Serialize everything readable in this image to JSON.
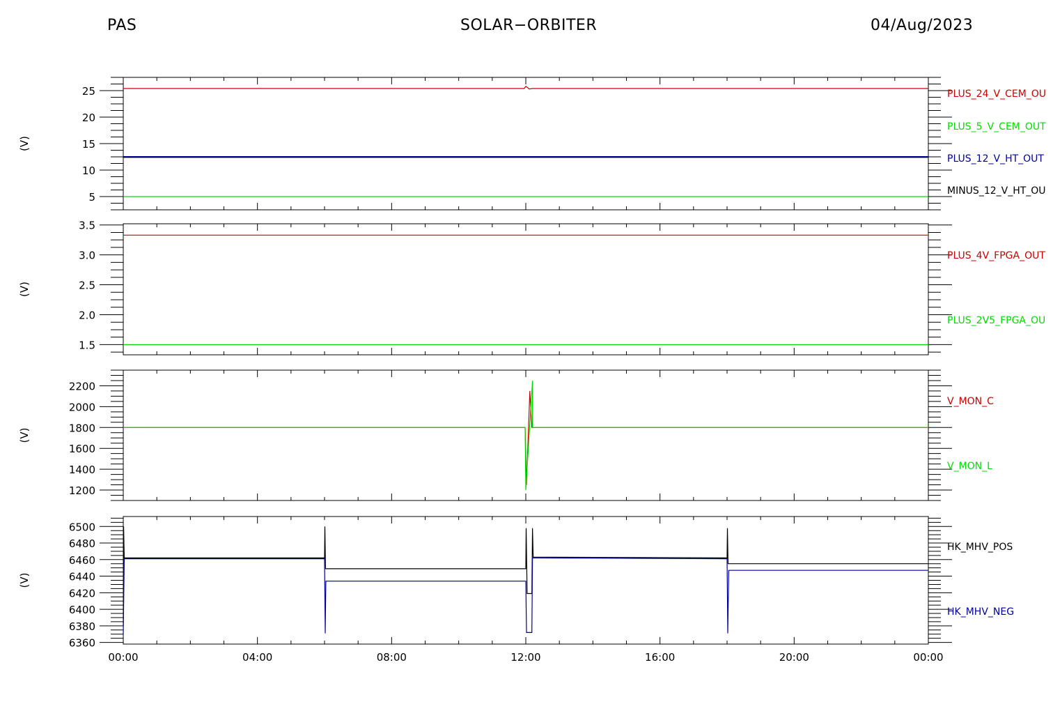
{
  "header": {
    "left": "PAS",
    "center": "SOLAR−ORBITER",
    "right": "04/Aug/2023"
  },
  "colors": {
    "red": "#cc0000",
    "green": "#00dd00",
    "blue": "#000099",
    "black": "#000000"
  },
  "chart_data": {
    "type": "line",
    "x_ticks": [
      "00:00",
      "04:00",
      "08:00",
      "12:00",
      "16:00",
      "20:00",
      "00:00"
    ],
    "xlim_hours": [
      0,
      24
    ],
    "panels": [
      {
        "ylabel": "(V)",
        "ylim": [
          2.5,
          27.5
        ],
        "yticks": [
          5,
          10,
          15,
          20,
          25
        ],
        "ytick_labels": [
          "5",
          "10",
          "15",
          "20",
          "25"
        ],
        "series": [
          {
            "name": "PLUS_24_V_CEM_OUT",
            "legend_text": "PLUS_24_V_CEM_OU",
            "color": "red",
            "x": [
              0,
              11.95,
              12.0,
              12.05,
              12.1,
              12.2,
              24
            ],
            "y": [
              25.4,
              25.4,
              25.8,
              25.6,
              25.3,
              25.4,
              25.4
            ]
          },
          {
            "name": "PLUS_5_V_CEM_OUT",
            "legend_text": "PLUS_5_V_CEM_OUT",
            "color": "green",
            "x": [
              0,
              24
            ],
            "y": [
              5.0,
              5.0
            ]
          },
          {
            "name": "PLUS_12_V_HT_OUT",
            "legend_text": "PLUS_12_V_HT_OUT",
            "color": "blue",
            "x": [
              0,
              24
            ],
            "y": [
              12.5,
              12.5
            ]
          },
          {
            "name": "MINUS_12_V_HT_OUT",
            "legend_text": "MINUS_12_V_HT_OU",
            "color": "black",
            "x": [
              0,
              24
            ],
            "y": [
              12.4,
              12.4
            ]
          }
        ]
      },
      {
        "ylabel": "(V)",
        "ylim": [
          1.33,
          3.52
        ],
        "yticks": [
          1.5,
          2.0,
          2.5,
          3.0,
          3.5
        ],
        "ytick_labels": [
          "1.5",
          "2.0",
          "2.5",
          "3.0",
          "3.5"
        ],
        "series": [
          {
            "name": "PLUS_4V_FPGA_OUT",
            "legend_text": "PLUS_4V_FPGA_OUT",
            "color": "red",
            "x": [
              0,
              24
            ],
            "y": [
              3.33,
              3.33
            ]
          },
          {
            "name": "PLUS_2V5_FPGA_OUT",
            "legend_text": "PLUS_2V5_FPGA_OU",
            "color": "green",
            "x": [
              0,
              24
            ],
            "y": [
              1.5,
              1.5
            ]
          }
        ]
      },
      {
        "ylabel": "(V)",
        "ylim": [
          1100,
          2350
        ],
        "yticks": [
          1200,
          1400,
          1600,
          1800,
          2000,
          2200
        ],
        "ytick_labels": [
          "1200",
          "1400",
          "1600",
          "1800",
          "2000",
          "2200"
        ],
        "series": [
          {
            "name": "V_MON_C",
            "legend_text": "V_MON_C",
            "color": "red",
            "x": [
              0,
              11.98,
              12.02,
              12.12,
              12.18,
              24
            ],
            "y": [
              1800,
              1800,
              1250,
              2150,
              1800,
              1800
            ]
          },
          {
            "name": "V_MON_L",
            "legend_text": "V_MON_L",
            "color": "green",
            "x": [
              0,
              11.98,
              12.0,
              12.2,
              12.2,
              12.25,
              24
            ],
            "y": [
              1800,
              1800,
              1200,
              2250,
              1800,
              1800,
              1800
            ]
          }
        ]
      },
      {
        "ylabel": "(V)",
        "ylim": [
          6358,
          6512
        ],
        "yticks": [
          6360,
          6380,
          6400,
          6420,
          6440,
          6460,
          6480,
          6500
        ],
        "ytick_labels": [
          "6360",
          "6380",
          "6400",
          "6420",
          "6440",
          "6460",
          "6480",
          "6500"
        ],
        "series": [
          {
            "name": "HK_MHV_POS",
            "legend_text": "HK_MHV_POS",
            "color": "black",
            "x": [
              0,
              0.01,
              0.03,
              0.05,
              0.06,
              6.0,
              6.01,
              6.03,
              6.05,
              12.0,
              12.01,
              12.04,
              12.06,
              12.18,
              12.2,
              12.22,
              18.0,
              18.01,
              18.03,
              18.06,
              24
            ],
            "y": [
              6380,
              6500,
              6462,
              6462,
              6462,
              6462,
              6500,
              6449,
              6449,
              6449,
              6498,
              6419,
              6419,
              6419,
              6498,
              6463,
              6462,
              6498,
              6455,
              6455,
              6455
            ]
          },
          {
            "name": "HK_MHV_NEG",
            "legend_text": "HK_MHV_NEG",
            "color": "blue",
            "x": [
              0,
              0.03,
              0.05,
              6.0,
              6.02,
              6.04,
              12.0,
              12.02,
              12.06,
              12.18,
              12.2,
              12.22,
              18.0,
              18.02,
              18.05,
              24
            ],
            "y": [
              6370,
              6461,
              6461,
              6461,
              6371,
              6434,
              6434,
              6372,
              6372,
              6372,
              6462,
              6462,
              6461,
              6371,
              6447,
              6447
            ]
          }
        ]
      }
    ]
  }
}
